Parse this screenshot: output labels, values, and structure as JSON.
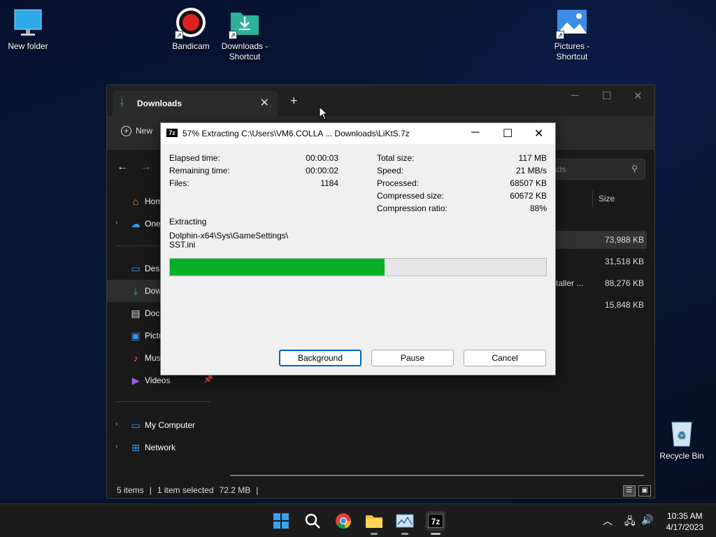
{
  "desktop": {
    "icons": [
      {
        "label": "New folder",
        "icon": "monitor-icon"
      },
      {
        "label": "Bandicam",
        "icon": "bandicam-record-icon"
      },
      {
        "label": "Downloads - Shortcut",
        "icon": "downloads-folder-icon"
      },
      {
        "label": "Pictures - Shortcut",
        "icon": "pictures-icon"
      },
      {
        "label": "Recycle Bin",
        "icon": "recycle-bin-icon"
      }
    ]
  },
  "explorer": {
    "tab_title": "Downloads",
    "toolbar_new": "New",
    "search_placeholder": "nloads",
    "sidebar": [
      {
        "label": "Hom",
        "icon": "home-icon"
      },
      {
        "label": "One",
        "icon": "onedrive-icon"
      },
      {
        "label": "Desk",
        "icon": "desktop-icon"
      },
      {
        "label": "Dow",
        "icon": "download-icon"
      },
      {
        "label": "Docu",
        "icon": "documents-icon"
      },
      {
        "label": "Pictu",
        "icon": "pictures-icon"
      },
      {
        "label": "Mus",
        "icon": "music-icon"
      },
      {
        "label": "Videos",
        "icon": "videos-icon"
      },
      {
        "label": "My Computer",
        "icon": "computer-icon"
      },
      {
        "label": "Network",
        "icon": "network-icon"
      }
    ],
    "column_size": "Size",
    "files": [
      {
        "name": "",
        "size": "73,988 KB"
      },
      {
        "name": "",
        "size": "31,518 KB"
      },
      {
        "name": "staller ...",
        "size": "88,276 KB"
      },
      {
        "name": "",
        "size": "15,848 KB"
      }
    ],
    "status": {
      "items": "5 items",
      "selected": "1 item selected",
      "size": "72.2 MB",
      "sep": "|"
    }
  },
  "dialog": {
    "title": "57% Extracting C:\\Users\\VM6.COLLA ... Downloads\\LiKtS.7z",
    "icon_text": "7z",
    "left_stats": [
      {
        "label": "Elapsed time:",
        "value": "00:00:03"
      },
      {
        "label": "Remaining time:",
        "value": "00:00:02"
      },
      {
        "label": "Files:",
        "value": "1184"
      }
    ],
    "right_stats": [
      {
        "label": "Total size:",
        "value": "117 MB"
      },
      {
        "label": "Speed:",
        "value": "21 MB/s"
      },
      {
        "label": "Processed:",
        "value": "68507 KB"
      },
      {
        "label": "Compressed size:",
        "value": "60672 KB"
      },
      {
        "label": "Compression ratio:",
        "value": "88%"
      }
    ],
    "action": "Extracting",
    "current_file_line1": "Dolphin-x64\\Sys\\GameSettings\\",
    "current_file_line2": "SST.ini",
    "progress_fraction": 0.57,
    "progress_color": "#06b025",
    "buttons": {
      "background": "Background",
      "pause": "Pause",
      "cancel": "Cancel"
    }
  },
  "taskbar": {
    "apps": [
      "windows-start-icon",
      "search-icon",
      "chrome-icon",
      "file-explorer-icon",
      "task-manager-icon",
      "7zip-icon"
    ],
    "time": "10:35 AM",
    "date": "4/17/2023"
  }
}
